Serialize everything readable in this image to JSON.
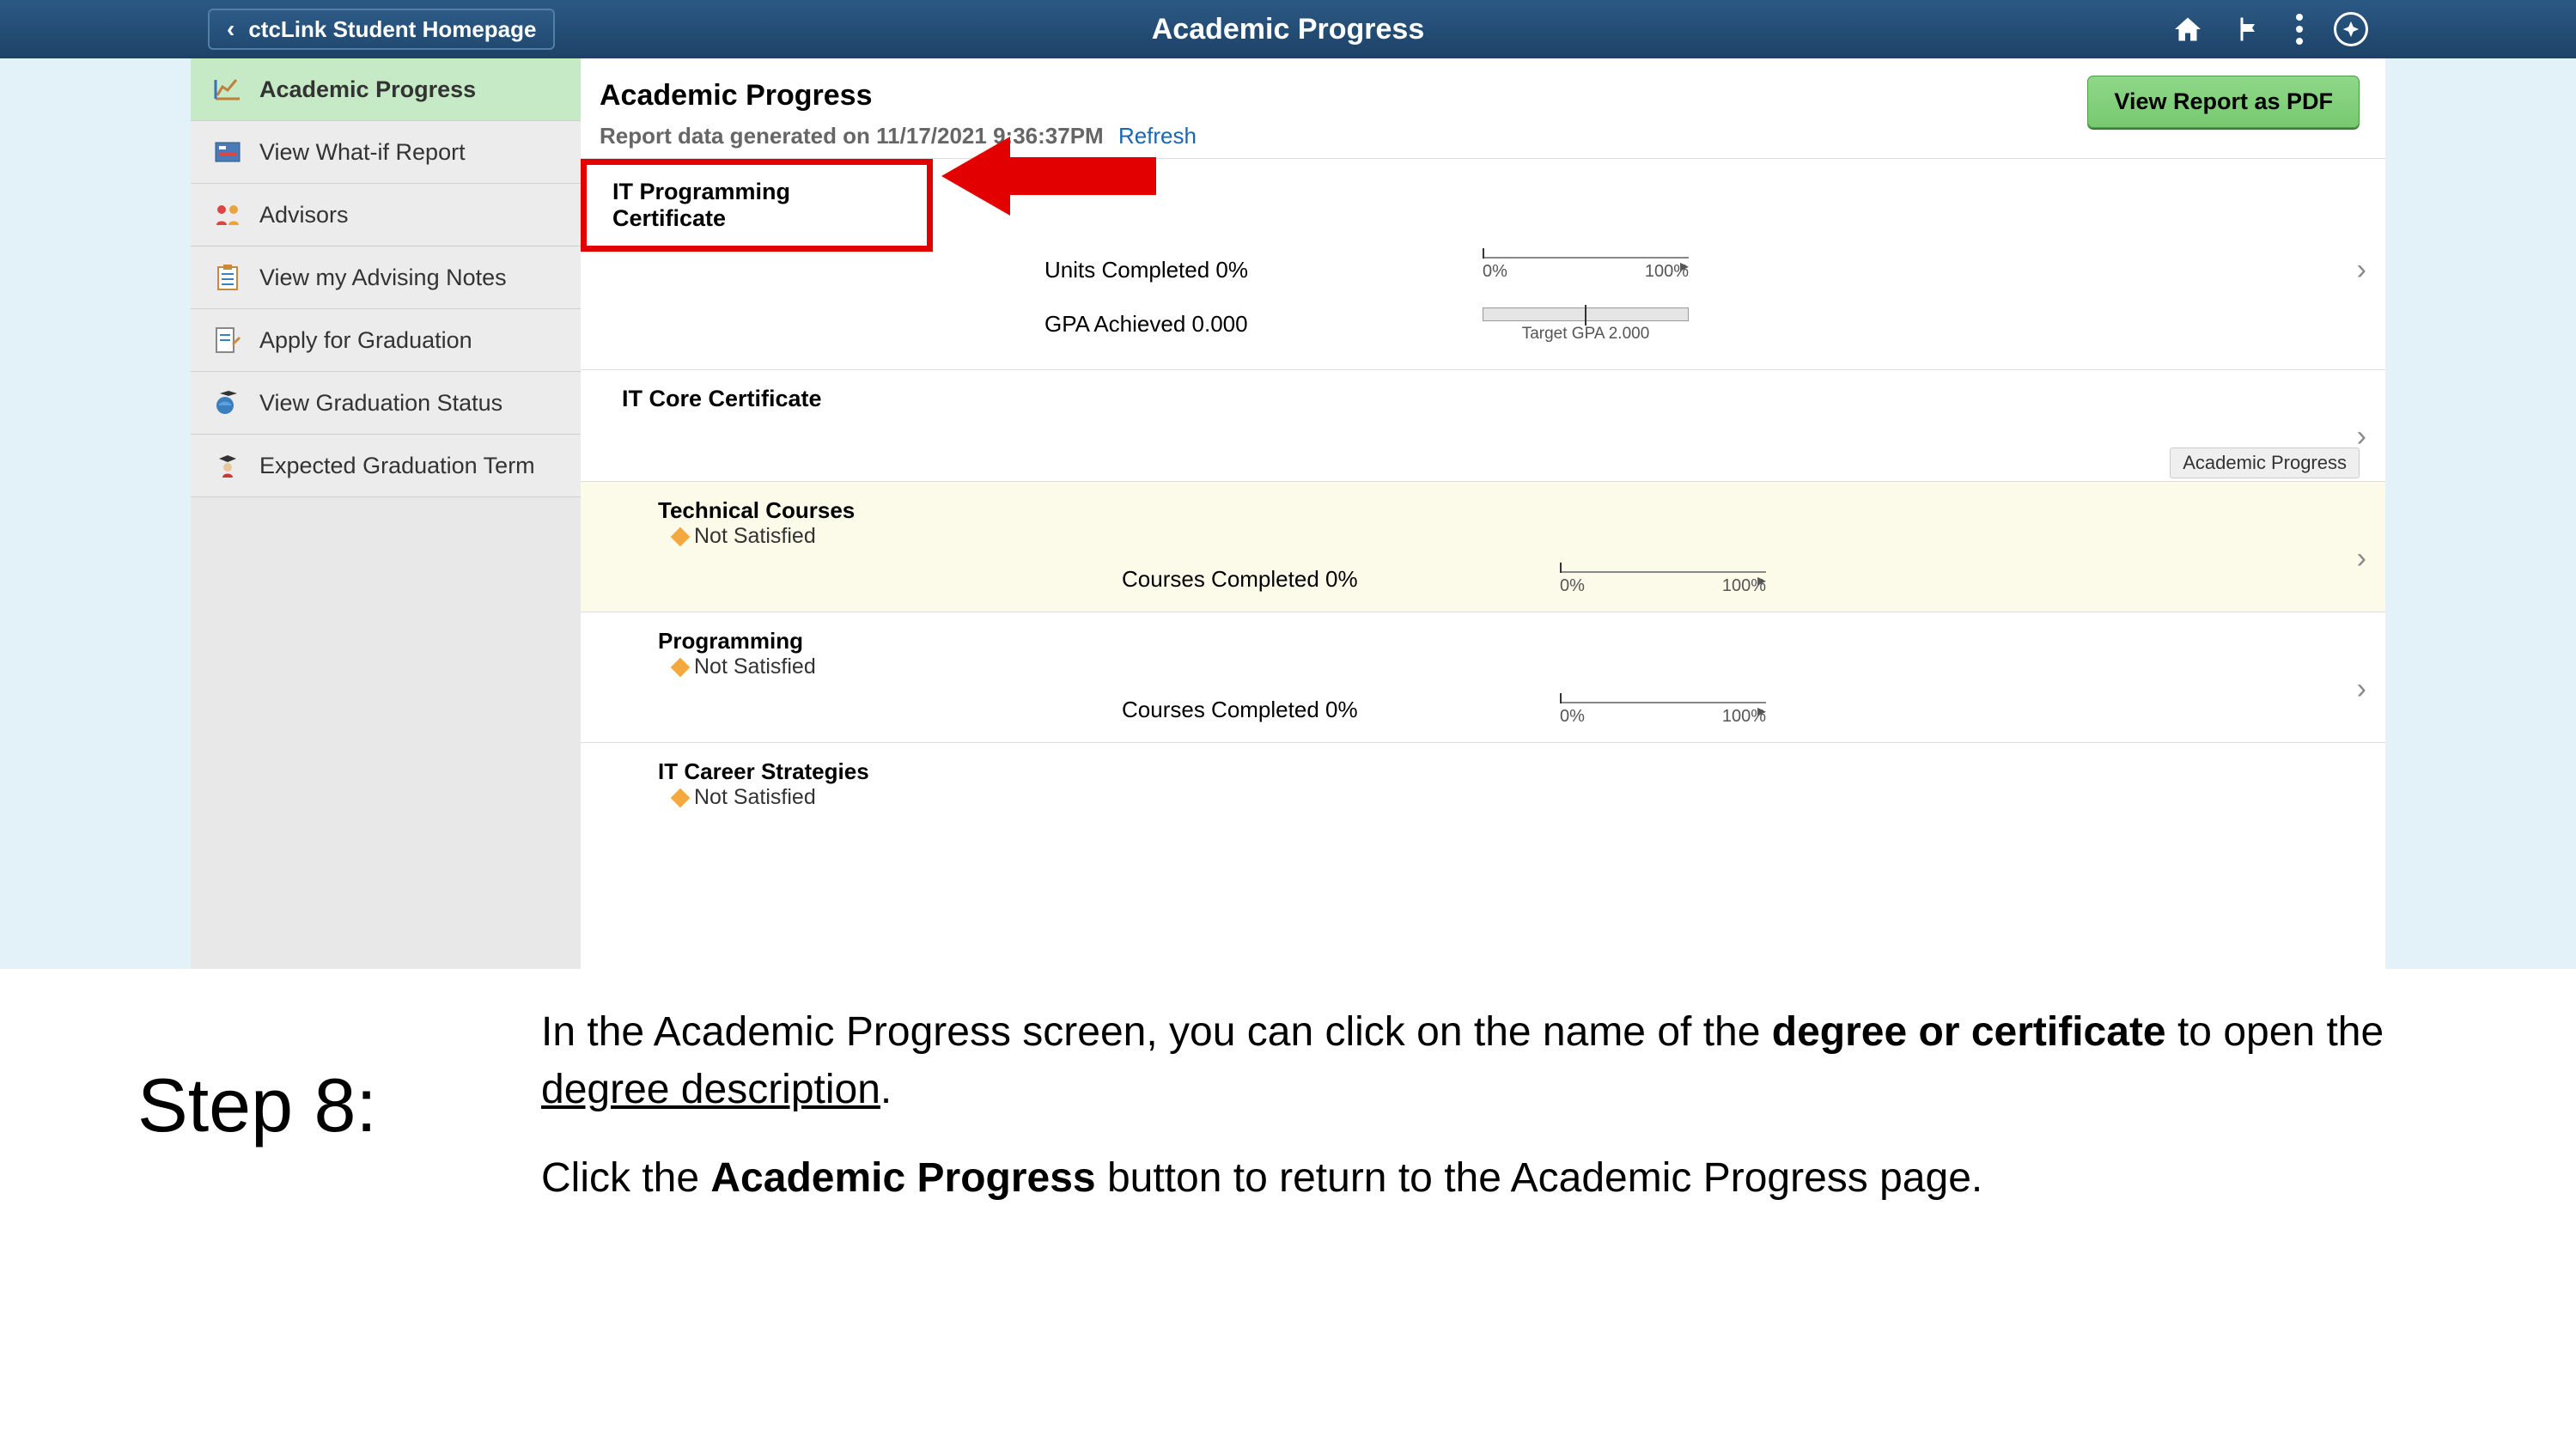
{
  "header": {
    "back": "ctcLink Student Homepage",
    "title": "Academic Progress"
  },
  "sidebar": [
    {
      "label": "Academic Progress"
    },
    {
      "label": "View What-if Report"
    },
    {
      "label": "Advisors"
    },
    {
      "label": "View my Advising Notes"
    },
    {
      "label": "Apply for Graduation"
    },
    {
      "label": "View Graduation Status"
    },
    {
      "label": "Expected Graduation Term"
    }
  ],
  "content": {
    "heading": "Academic Progress",
    "report_prefix": "Report data generated on ",
    "report_date": "11/17/2021 9:36:37PM",
    "refresh": "Refresh",
    "pdf_btn": "View Report as PDF",
    "cert_title": "IT Programming Certificate",
    "units_lbl": "Units Completed 0%",
    "pct0": "0%",
    "pct100": "100%",
    "gpa_lbl": "GPA Achieved  0.000",
    "gpa_target": "Target GPA 2.000",
    "core_title": "IT Core Certificate",
    "tech_title": "Technical Courses",
    "not_sat": "Not Satisfied",
    "courses_lbl": "Courses Completed 0%",
    "prog_title": "Programming",
    "itcs_title": "IT Career Strategies",
    "tooltip": "Academic Progress"
  },
  "instruction": {
    "step": "Step 8:",
    "p1a": "In the Academic Progress screen, you can click on the name of the ",
    "p1b": "degree or certificate",
    "p1c": " to open the ",
    "p1d": "degree description",
    "p1e": ".",
    "p2a": "Click the ",
    "p2b": "Academic Progress",
    "p2c": " button to return to the Academic Progress page."
  }
}
